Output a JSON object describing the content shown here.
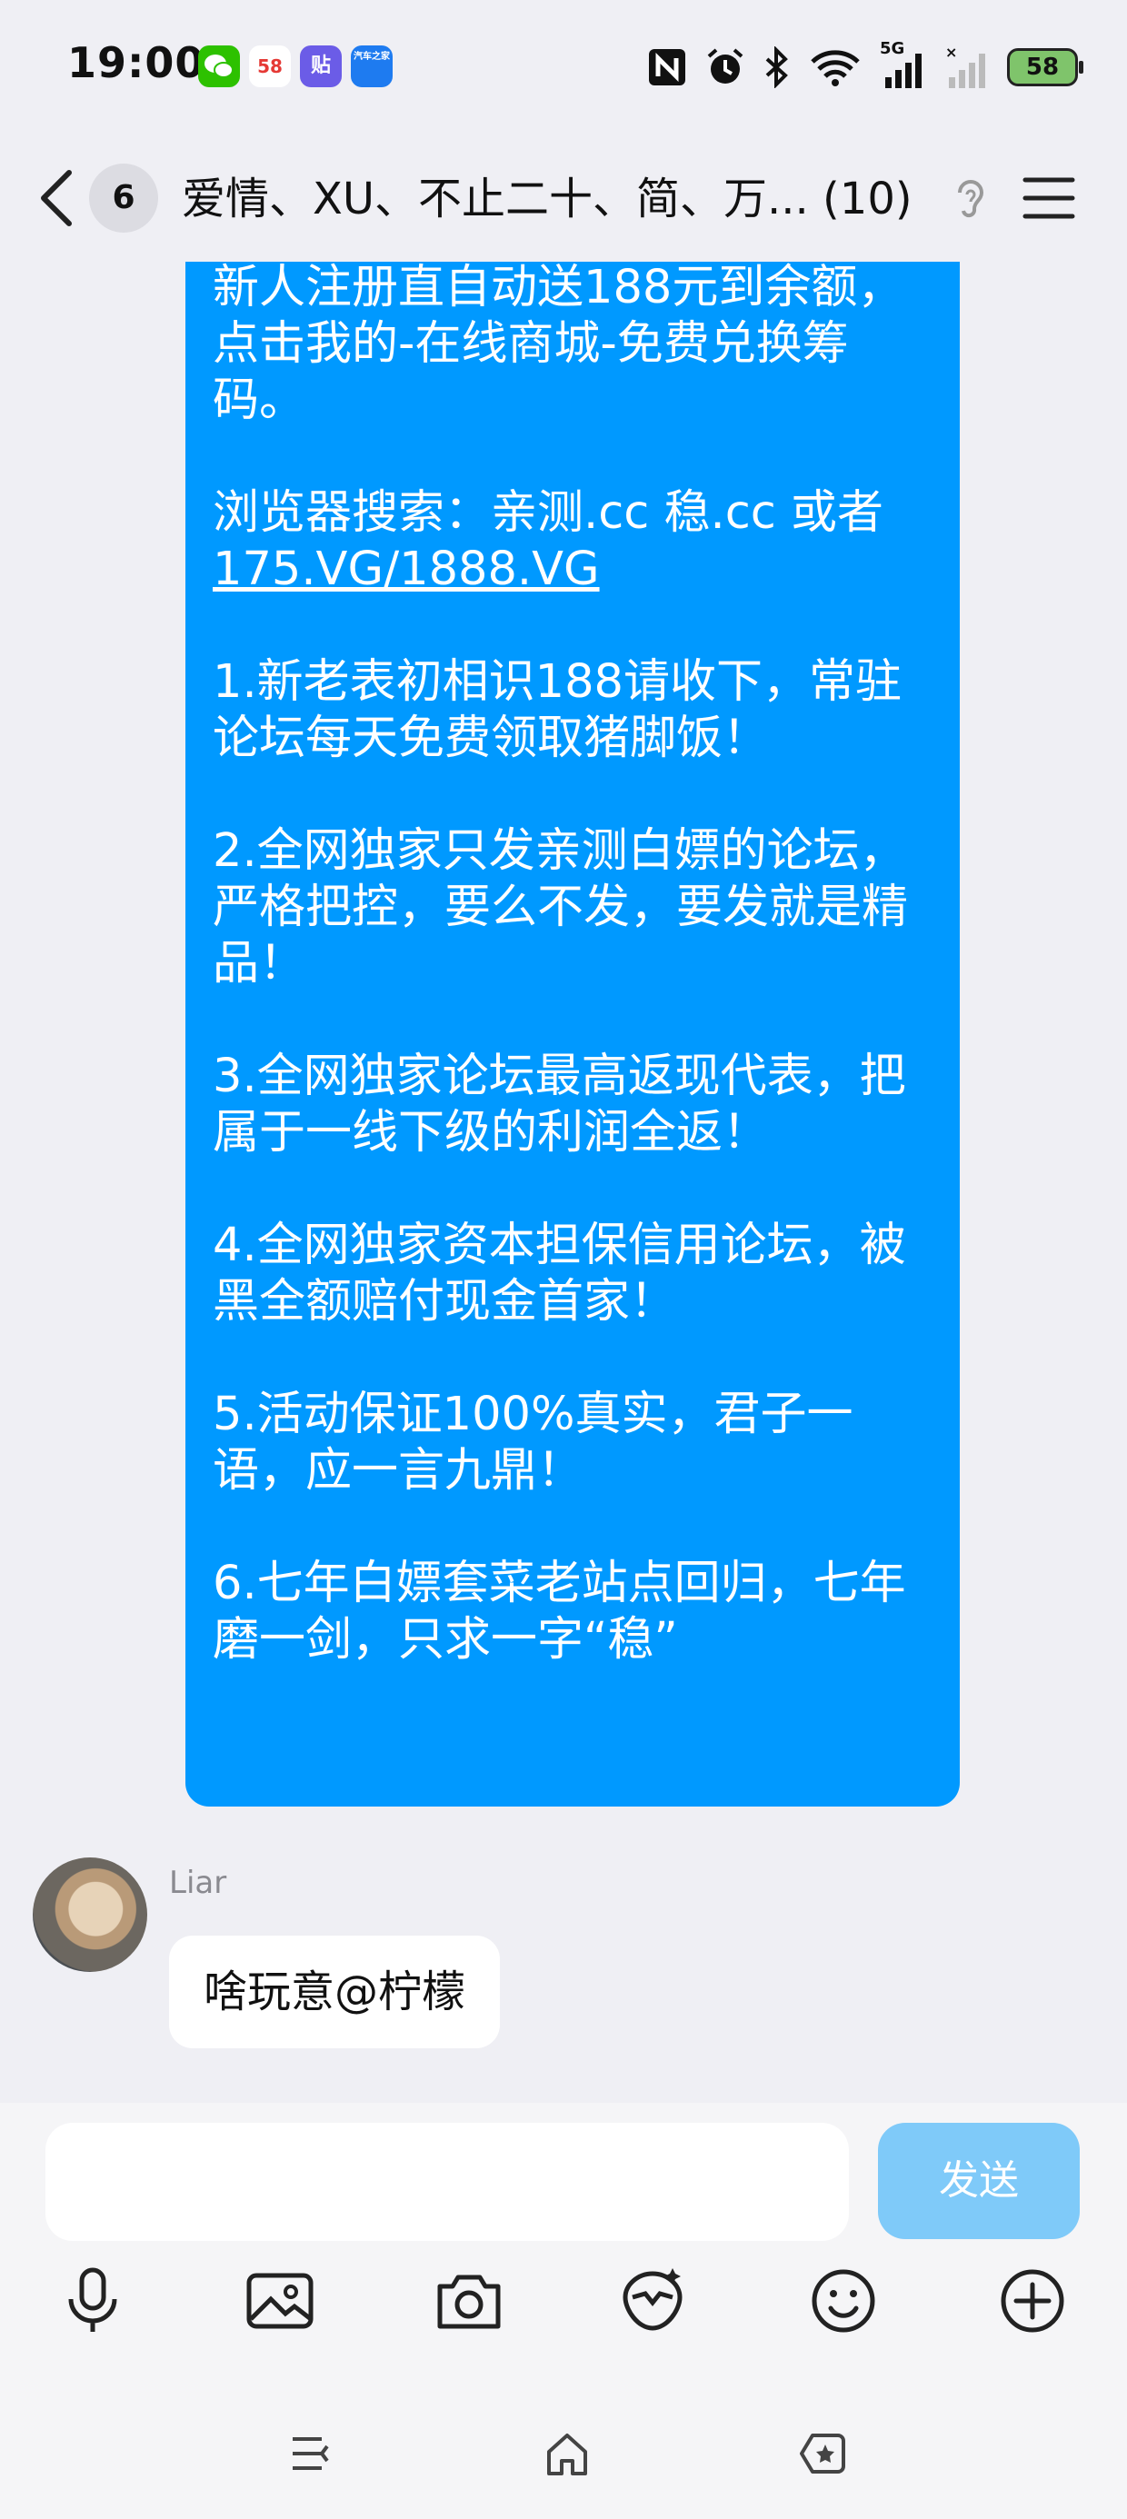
{
  "status_bar": {
    "time": "19:00",
    "apps": [
      {
        "icon": "wechat-icon",
        "color": "#2dc100"
      },
      {
        "icon": "58-city-icon",
        "label": "58",
        "color": "#f5f5f5"
      },
      {
        "icon": "tieba-icon",
        "label": "贴",
        "color": "#6b5ce7"
      },
      {
        "icon": "autohome-icon",
        "label": "汽车之家",
        "color": "#1e7bf0"
      }
    ],
    "network": "5G",
    "battery": "58"
  },
  "nav": {
    "unread_count": "6",
    "title": "爱情、XU、不止二十、简、万... (10)"
  },
  "messages": [
    {
      "type": "outgoing",
      "color": "#0099ff",
      "lines_before_link": "新人注册直自动送188元到余额，点击我的-在线商城-免费兑换筹码。\n\n浏览器搜索：亲测.cc 稳.cc 或者\n",
      "link": "175.VG/1888.VG",
      "lines_after_link": "\n\n1.新老表初相识188请收下，常驻论坛每天免费领取猪脚饭！\n\n2.全网独家只发亲测白嫖的论坛，严格把控，要么不发，要发就是精品！\n\n3.全网独家论坛最高返现代表，把属于一线下级的利润全返！\n\n4.全网独家资本担保信用论坛，被黑全额赔付现金首家！\n\n5.活动保证100%真实，君子一语，应一言九鼎！\n\n6.七年白嫖套菜老站点回归，七年磨一剑，只求一字“稳”"
    },
    {
      "type": "incoming",
      "sender": "Liar",
      "text": "啥玩意@柠檬"
    }
  ],
  "composer": {
    "placeholder": "",
    "send_label": "发送"
  },
  "toolbar": [
    "microphone-icon",
    "image-icon",
    "camera-icon",
    "hongbao-icon",
    "emoji-icon",
    "plus-icon"
  ],
  "system_nav": [
    "menu-icon",
    "home-icon",
    "back-icon"
  ]
}
